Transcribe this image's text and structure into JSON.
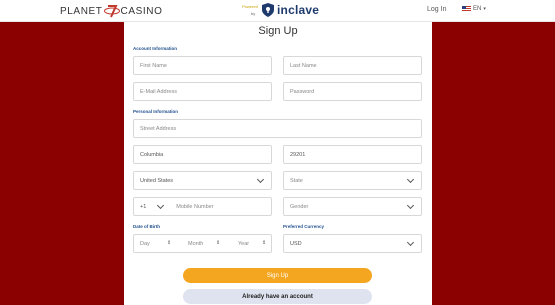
{
  "header": {
    "logo_left": "PLANET",
    "logo_right": "CASINO",
    "powered_label": "Powered",
    "by_label": "by",
    "partner_name": "inclave",
    "login_label": "Log In",
    "language_label": "EN"
  },
  "form": {
    "title": "Sign Up",
    "account_section": "Account Information",
    "personal_section": "Personal Information",
    "dob_label": "Date of Birth",
    "currency_label": "Preferred Currency",
    "first_name_placeholder": "First Name",
    "last_name_placeholder": "Last Name",
    "email_placeholder": "E-Mail Address",
    "password_placeholder": "Password",
    "street_placeholder": "Street Address",
    "city_value": "Columbia",
    "zip_value": "29201",
    "country_value": "United States",
    "state_placeholder": "State",
    "phone_code": "+1",
    "mobile_placeholder": "Mobile Number",
    "gender_placeholder": "Gender",
    "dob_day": "Day",
    "dob_month": "Month",
    "dob_year": "Year",
    "currency_value": "USD",
    "signup_button": "Sign Up",
    "account_button": "Already have an account"
  },
  "colors": {
    "background": "#8b0000",
    "accent": "#f4a620",
    "section_label": "#1e4e8c"
  }
}
